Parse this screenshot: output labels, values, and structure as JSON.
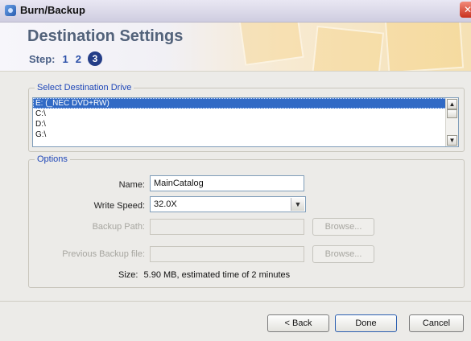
{
  "window": {
    "title": "Burn/Backup",
    "close_glyph": "✕"
  },
  "header": {
    "title": "Destination Settings",
    "step_label": "Step:",
    "steps": [
      "1",
      "2",
      "3"
    ],
    "current_step": "3"
  },
  "drive_section": {
    "legend": "Select Destination Drive",
    "drives": [
      "E: (_NEC DVD+RW)",
      "C:\\",
      "D:\\",
      "G:\\"
    ],
    "selected": "E: (_NEC DVD+RW)"
  },
  "options": {
    "legend": "Options",
    "name_label": "Name:",
    "name_value": "MainCatalog",
    "speed_label": "Write Speed:",
    "speed_value": "32.0X",
    "backup_path_label": "Backup Path:",
    "backup_path_value": "",
    "prev_backup_label": "Previous Backup file:",
    "prev_backup_value": "",
    "browse_label": "Browse...",
    "size_label": "Size:",
    "size_value": "5.90 MB, estimated time of 2 minutes"
  },
  "footer": {
    "back_label": "< Back",
    "done_label": "Done",
    "cancel_label": "Cancel"
  },
  "colors": {
    "accent": "#316ac5",
    "legend_blue": "#1f47b8",
    "title_slate": "#52627a",
    "step_badge": "#243d87"
  }
}
